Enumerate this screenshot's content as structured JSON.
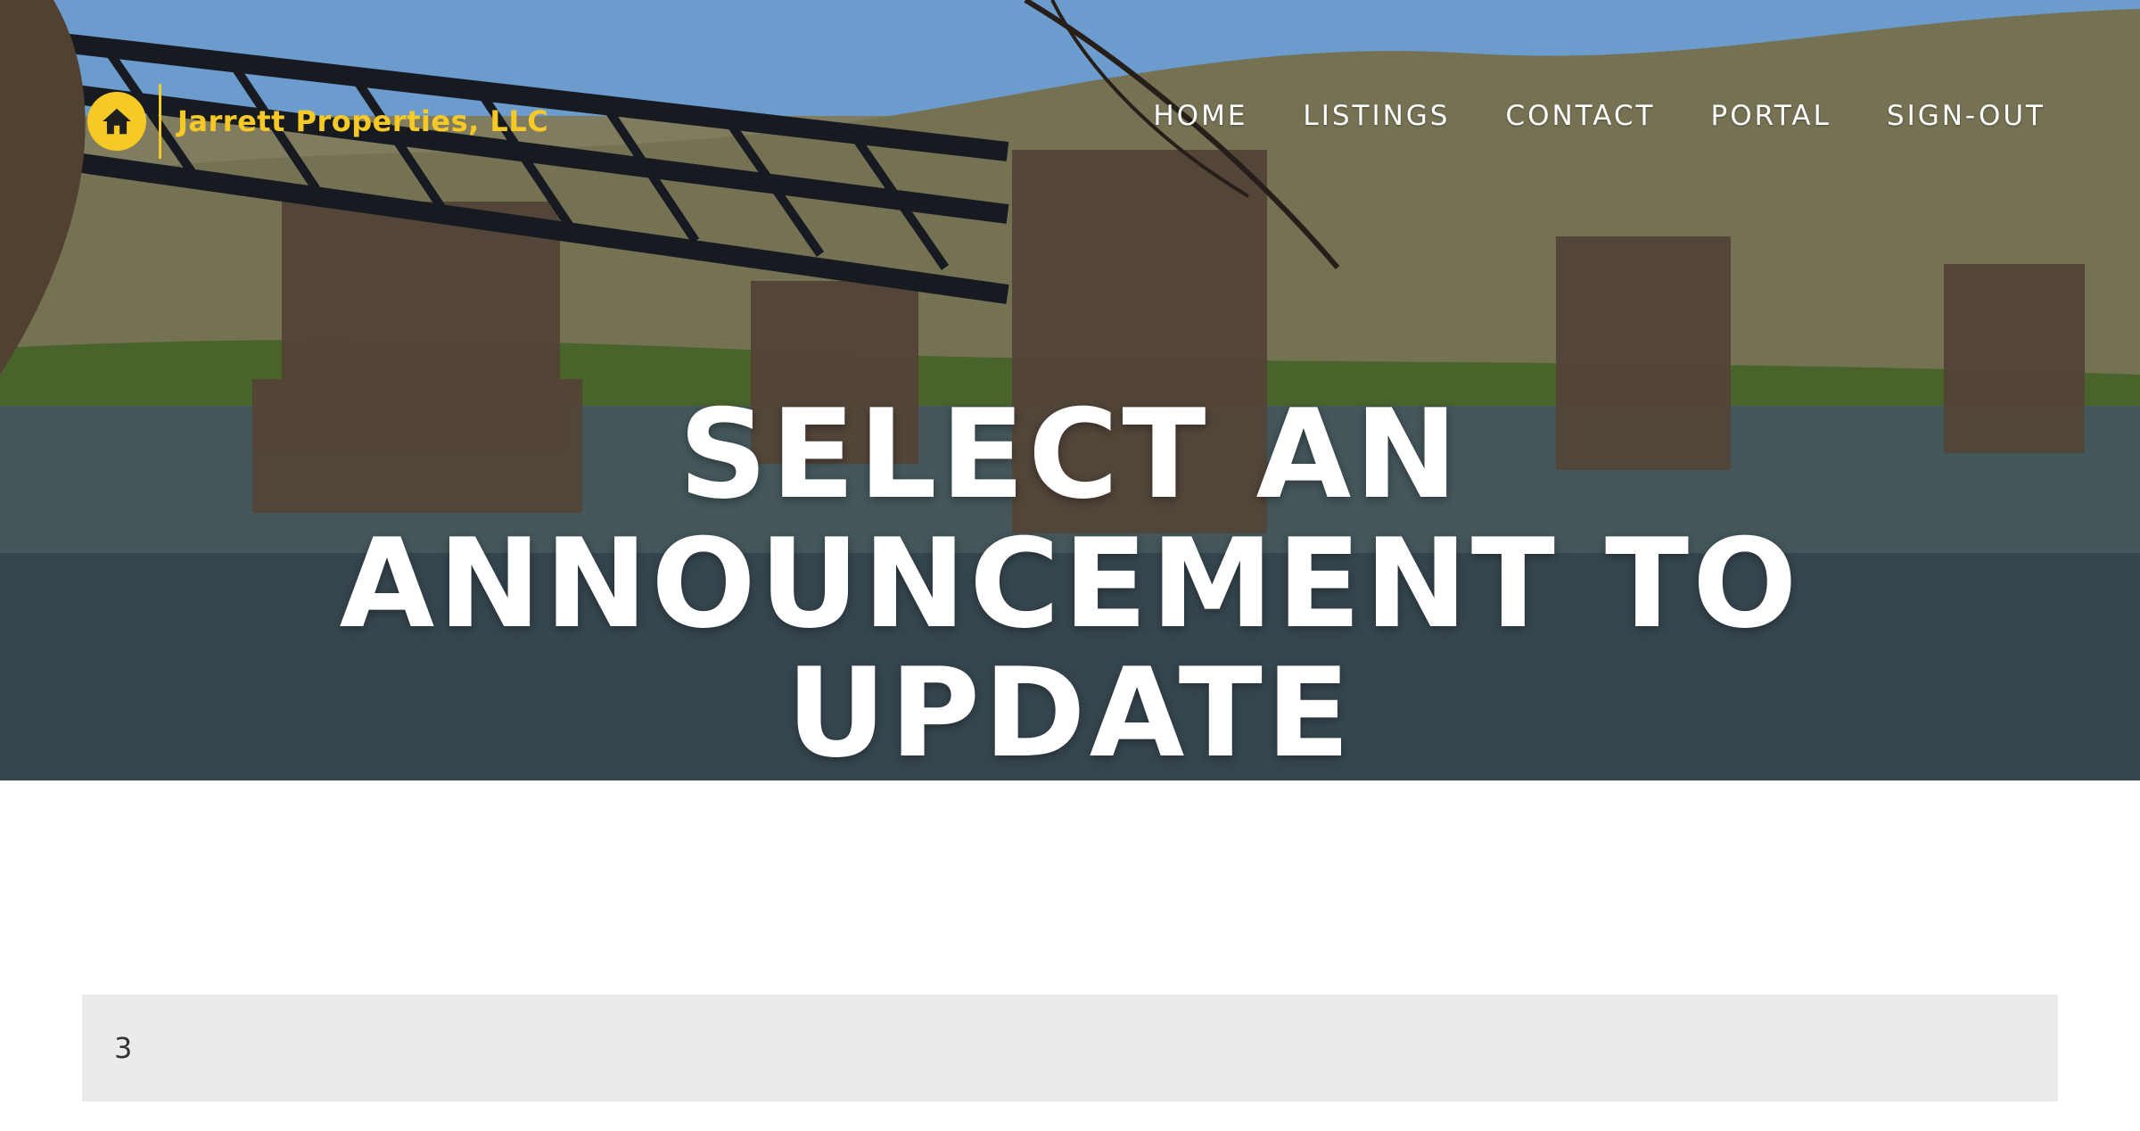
{
  "brand": {
    "name": "Jarrett Properties, LLC",
    "icon": "home-icon",
    "accent_color": "#f6c927"
  },
  "nav": {
    "items": [
      {
        "label": "HOME"
      },
      {
        "label": "LISTINGS"
      },
      {
        "label": "CONTACT"
      },
      {
        "label": "PORTAL"
      },
      {
        "label": "SIGN-OUT"
      }
    ]
  },
  "hero": {
    "title": "SELECT AN ANNOUNCEMENT TO UPDATE"
  },
  "announcement_select": {
    "value": "3"
  }
}
